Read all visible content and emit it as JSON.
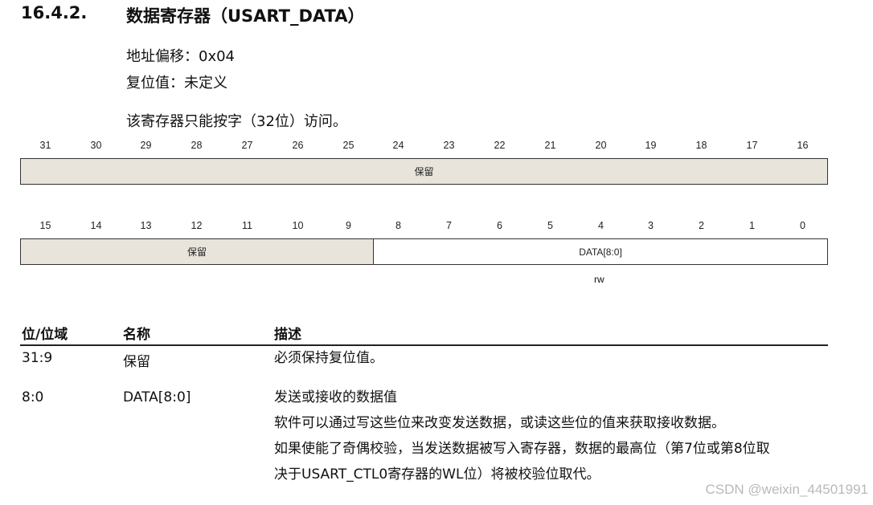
{
  "section": {
    "number": "16.4.2.",
    "title": "数据寄存器（USART_DATA）",
    "offset": "地址偏移：0x04",
    "reset": "复位值：未定义",
    "access_note": "该寄存器只能按字（32位）访问。"
  },
  "register": {
    "upper_bits": [
      "31",
      "30",
      "29",
      "28",
      "27",
      "26",
      "25",
      "24",
      "23",
      "22",
      "21",
      "20",
      "19",
      "18",
      "17",
      "16"
    ],
    "upper_field": "保留",
    "lower_bits": [
      "15",
      "14",
      "13",
      "12",
      "11",
      "10",
      "9",
      "8",
      "7",
      "6",
      "5",
      "4",
      "3",
      "2",
      "1",
      "0"
    ],
    "lower_reserved": "保留",
    "lower_data": "DATA[8:0]",
    "access": "rw"
  },
  "table": {
    "headers": [
      "位/位域",
      "名称",
      "描述"
    ],
    "rows": [
      {
        "bits": "31:9",
        "name": "保留",
        "desc": [
          "必须保持复位值。"
        ]
      },
      {
        "bits": "8:0",
        "name": "DATA[8:0]",
        "desc": [
          "发送或接收的数据值",
          "软件可以通过写这些位来改变发送数据，或读这些位的值来获取接收数据。",
          "如果使能了奇偶校验，当发送数据被写入寄存器，数据的最高位（第7位或第8位取",
          "决于USART_CTL0寄存器的WL位）将被校验位取代。"
        ]
      }
    ]
  },
  "watermark": "CSDN @weixin_44501991"
}
